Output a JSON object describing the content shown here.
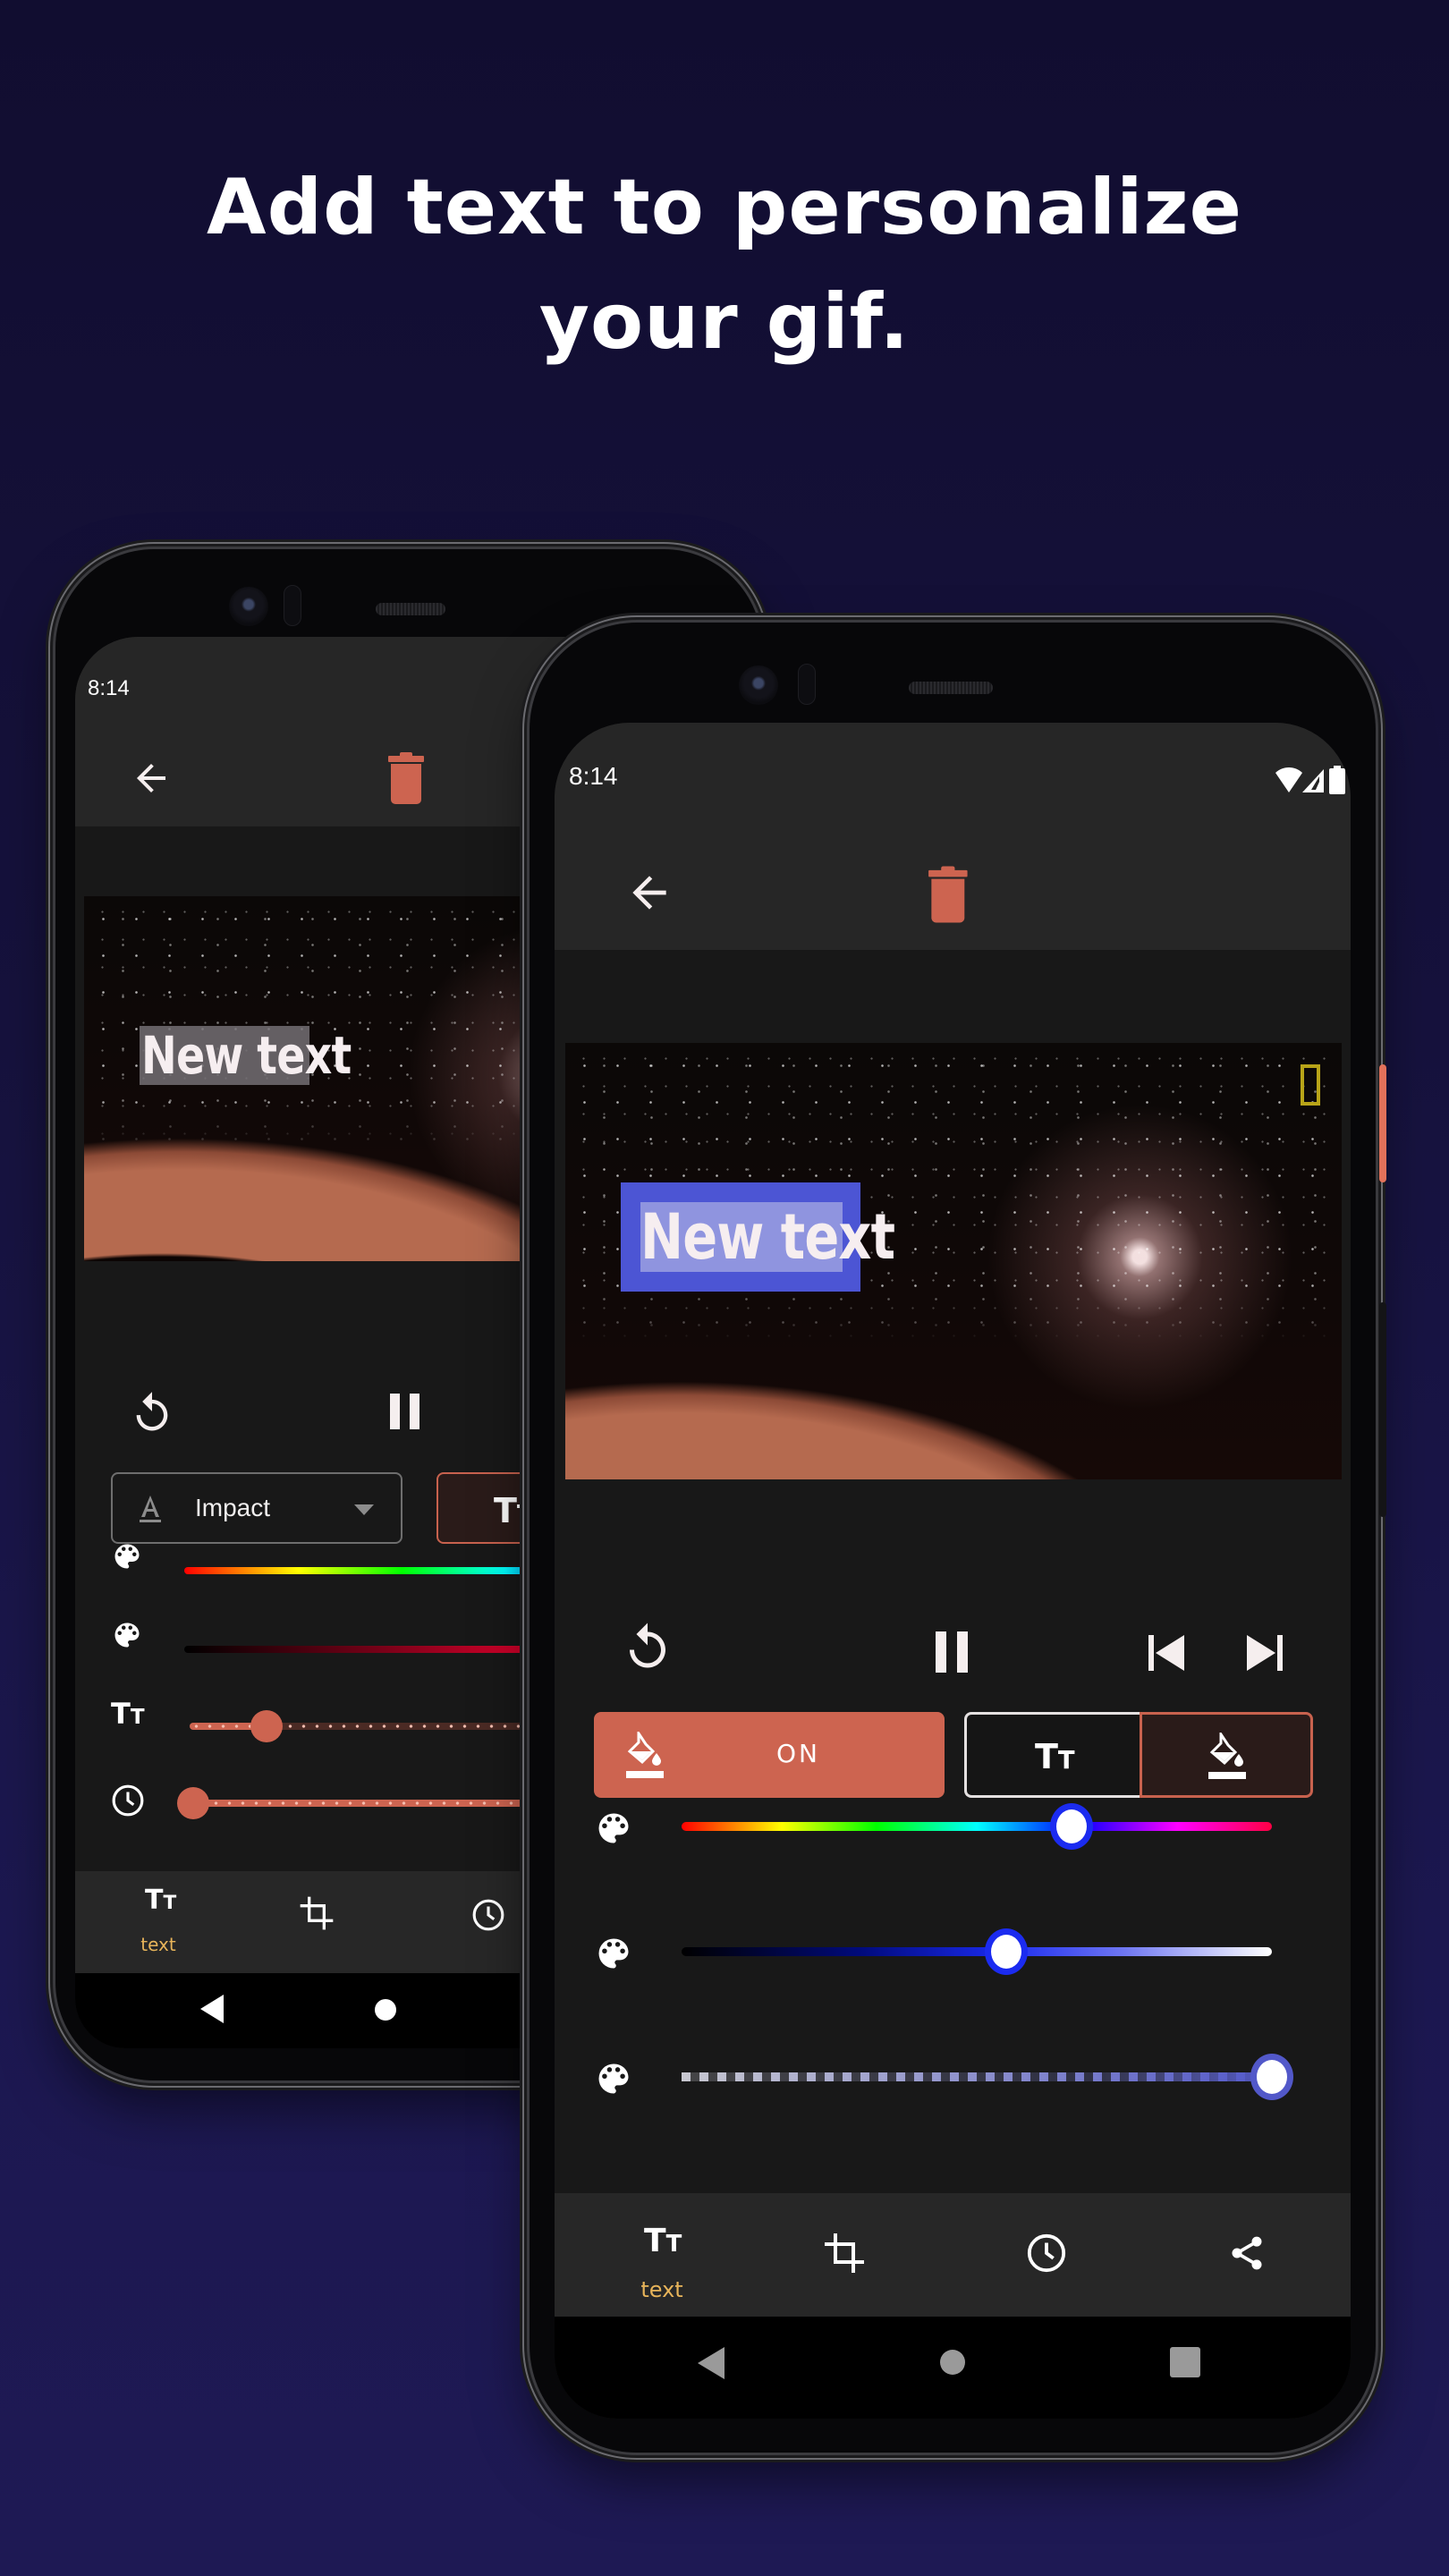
{
  "headline": {
    "line1": "Add text to personalize",
    "line2": "your gif."
  },
  "colors": {
    "accent": "#cd6450",
    "nav_active": "#e7b45a",
    "slider_blue": "#1b2bf0",
    "slider_indigo": "#5258c9",
    "text_box_bg": "#4c55d4"
  },
  "back_phone": {
    "status_time": "8:14",
    "toolbar": {
      "back_icon": "arrow-left-icon",
      "delete_icon": "trash-icon"
    },
    "gif": {
      "overlay_text": "New text"
    },
    "playback": {
      "replay_icon": "replay-icon",
      "pause_icon": "pause-icon"
    },
    "font_select": {
      "icon": "text-format-icon",
      "value": "Impact"
    },
    "style_toggle_icon": "text-size-icon",
    "sliders": [
      {
        "icon": "palette-icon",
        "type": "hue"
      },
      {
        "icon": "palette-icon",
        "type": "shade-red"
      },
      {
        "icon": "text-size-icon",
        "type": "size",
        "value_fraction": 0.23
      },
      {
        "icon": "clock-icon",
        "type": "duration",
        "value_fraction": 0.0
      }
    ],
    "bottom_nav": [
      {
        "icon": "text-size-icon",
        "label": "text",
        "active": true
      },
      {
        "icon": "crop-icon",
        "label": ""
      },
      {
        "icon": "clock-icon",
        "label": ""
      }
    ],
    "system_nav": [
      "back",
      "home"
    ]
  },
  "front_phone": {
    "status_time": "8:14",
    "status_icons": [
      "wifi-icon",
      "signal-icon",
      "battery-icon"
    ],
    "toolbar": {
      "back_icon": "arrow-left-icon",
      "delete_icon": "trash-icon"
    },
    "gif": {
      "overlay_text": "New text",
      "watermark_icon": "frame-logo-icon"
    },
    "playback": {
      "replay_icon": "replay-icon",
      "pause_icon": "pause-icon",
      "prev_icon": "skip-previous-icon",
      "next_icon": "skip-next-icon"
    },
    "background_toggle": {
      "icon": "fill-color-icon",
      "label": "ON"
    },
    "segmented": [
      {
        "icon": "text-size-icon",
        "selected": false
      },
      {
        "icon": "fill-color-icon",
        "selected": true
      }
    ],
    "sliders": [
      {
        "icon": "palette-icon",
        "type": "hue",
        "value_fraction": 0.66
      },
      {
        "icon": "palette-icon",
        "type": "shade-blue",
        "value_fraction": 0.55
      },
      {
        "icon": "palette-icon",
        "type": "opacity",
        "value_fraction": 1.0
      }
    ],
    "bottom_nav": [
      {
        "icon": "text-size-icon",
        "label": "text",
        "active": true
      },
      {
        "icon": "crop-icon",
        "label": ""
      },
      {
        "icon": "clock-icon",
        "label": ""
      },
      {
        "icon": "share-icon",
        "label": ""
      }
    ],
    "system_nav": [
      "back",
      "home",
      "recents"
    ]
  }
}
